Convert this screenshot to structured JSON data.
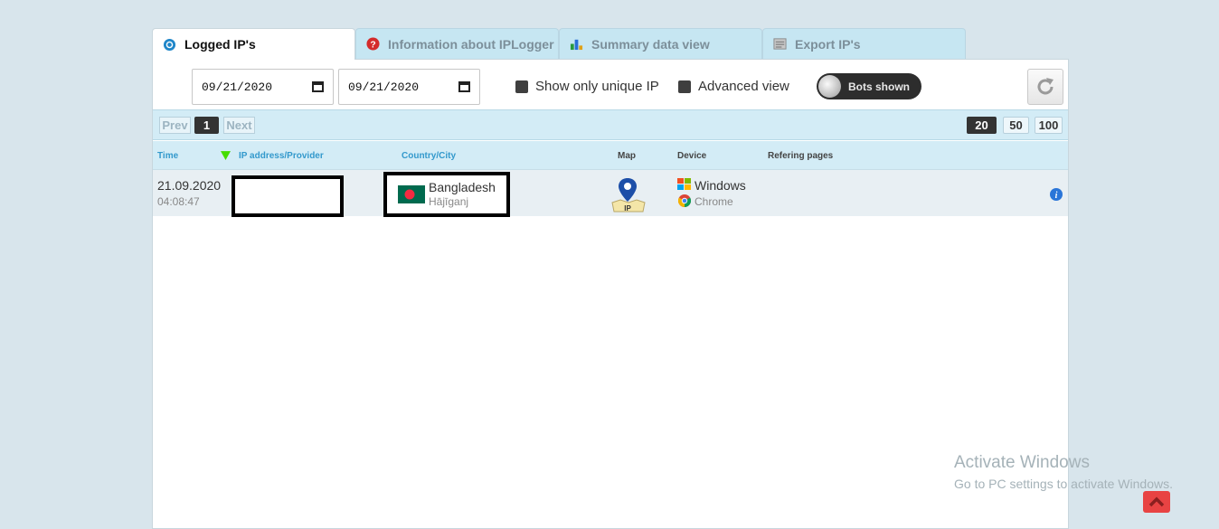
{
  "tabs": [
    {
      "label": "Logged IP's",
      "icon": "eye-icon",
      "active": true
    },
    {
      "label": "Information about IPLogger",
      "icon": "question-icon",
      "active": false
    },
    {
      "label": "Summary data view",
      "icon": "bar-chart-icon",
      "active": false
    },
    {
      "label": "Export IP's",
      "icon": "document-icon",
      "active": false
    }
  ],
  "filters": {
    "date_from": "09/21/2020",
    "date_to": "09/21/2020",
    "unique_ip_label": "Show only unique IP",
    "unique_ip_checked": false,
    "advanced_view_label": "Advanced view",
    "advanced_view_checked": false,
    "bots_toggle_label": "Bots shown"
  },
  "pagination": {
    "prev_label": "Prev",
    "current_page": "1",
    "next_label": "Next",
    "page_sizes": [
      "20",
      "50",
      "100"
    ],
    "selected_page_size": "20"
  },
  "table": {
    "headers": {
      "time": "Time",
      "ip": "IP address/Provider",
      "country": "Country/City",
      "map": "Map",
      "device": "Device",
      "referring": "Refering pages"
    },
    "rows": [
      {
        "date": "21.09.2020",
        "time": "04:08:47",
        "country": "Bangladesh",
        "city": "Hājīganj",
        "os": "Windows",
        "browser": "Chrome",
        "map_pin_label": "IP"
      }
    ]
  },
  "watermark": {
    "title": "Activate Windows",
    "subtitle": "Go to PC settings to activate Windows."
  },
  "colors": {
    "accent": "#3399cc",
    "tab_bg": "#c6e6f2",
    "header_bg": "#d3ecf6",
    "flag_green": "#006a4e",
    "flag_red": "#f42a41",
    "scroll_button": "#e84343"
  }
}
